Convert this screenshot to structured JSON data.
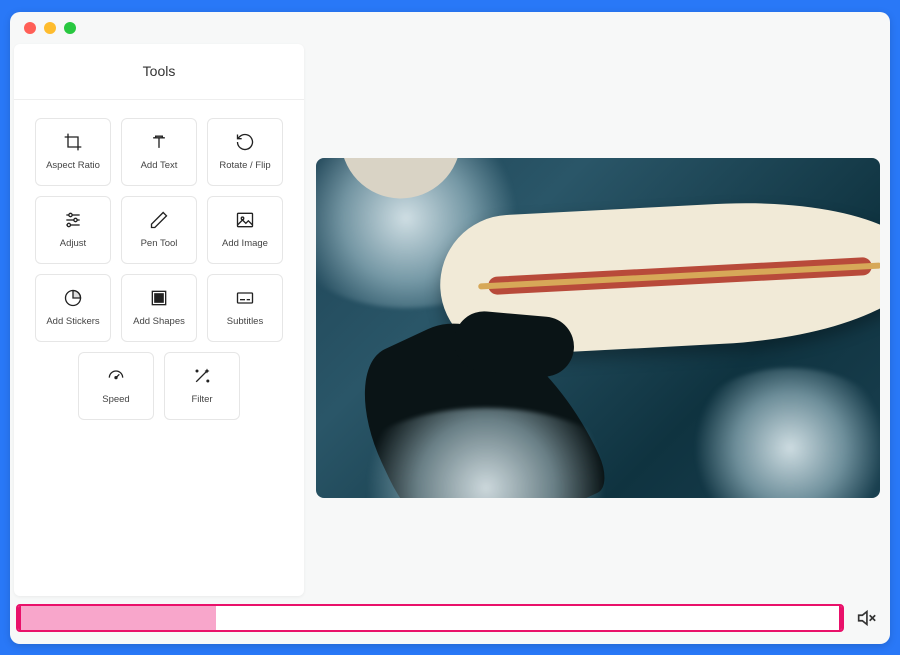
{
  "sidebar": {
    "title": "Tools",
    "items": [
      {
        "label": "Aspect Ratio",
        "icon": "crop-icon"
      },
      {
        "label": "Add Text",
        "icon": "text-icon"
      },
      {
        "label": "Rotate / Flip",
        "icon": "rotate-icon"
      },
      {
        "label": "Adjust",
        "icon": "sliders-icon"
      },
      {
        "label": "Pen Tool",
        "icon": "pen-icon"
      },
      {
        "label": "Add Image",
        "icon": "image-icon"
      },
      {
        "label": "Add Stickers",
        "icon": "sticker-icon"
      },
      {
        "label": "Add Shapes",
        "icon": "shapes-icon"
      },
      {
        "label": "Subtitles",
        "icon": "subtitles-icon"
      },
      {
        "label": "Speed",
        "icon": "speed-icon"
      },
      {
        "label": "Filter",
        "icon": "wand-icon"
      }
    ]
  },
  "timeline": {
    "progress_percent": 24,
    "muted": true
  },
  "colors": {
    "accent": "#e9116a",
    "background": "#2978f7"
  }
}
